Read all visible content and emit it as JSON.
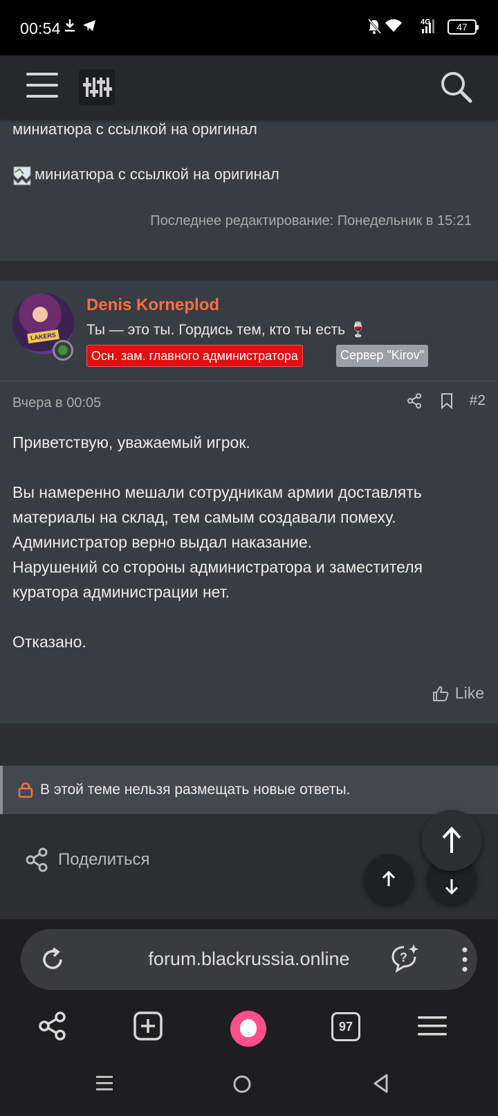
{
  "status_bar": {
    "time": "00:54",
    "network": "4G",
    "battery": "47",
    "icons": [
      "download-icon",
      "telegram-icon",
      "bell-off-icon",
      "wifi-icon",
      "signal-icon",
      "battery-icon"
    ]
  },
  "header": {
    "menu_icon": "hamburger-icon",
    "logo_icon": "sliders-logo-icon",
    "search_icon": "search-icon"
  },
  "previous_post": {
    "text_line": "миниатюра с ссылкой на оригинал",
    "image_alt": "миниатюра с ссылкой на оригинал",
    "last_edited": "Последнее редактирование: Понедельник в 15:21"
  },
  "post": {
    "author": "Denis Korneplod",
    "user_title": "Ты — это ты. Гордись тем, кто ты есть 🍷",
    "badges": [
      {
        "label": "Осн. зам. главного администратора",
        "color": "#e01010"
      },
      {
        "label": "Сервер \"Kirov\"",
        "color": "#9aa0a6"
      }
    ],
    "date": "Вчера в 00:05",
    "post_number": "#2",
    "paragraphs": [
      "Приветствую, уважаемый игрок.",
      "",
      "Вы намеренно мешали сотрудникам армии доставлять материалы на склад, тем самым создавали помеху.",
      "Администратор верно выдал наказание.",
      "Нарушений со стороны администратора и заместителя куратора администрации нет.",
      "",
      "Отказано."
    ],
    "like_label": "Like"
  },
  "locked_notice": "В этой теме нельзя размещать новые ответы.",
  "share_label": "Поделиться",
  "browser": {
    "url": "forum.blackrussia.online",
    "tabs_count": "97"
  },
  "colors": {
    "accent_username": "#ff6e40",
    "background": "#2b2e33",
    "post_bg": "#383c43",
    "alice_pink": "#ff4f8b"
  }
}
